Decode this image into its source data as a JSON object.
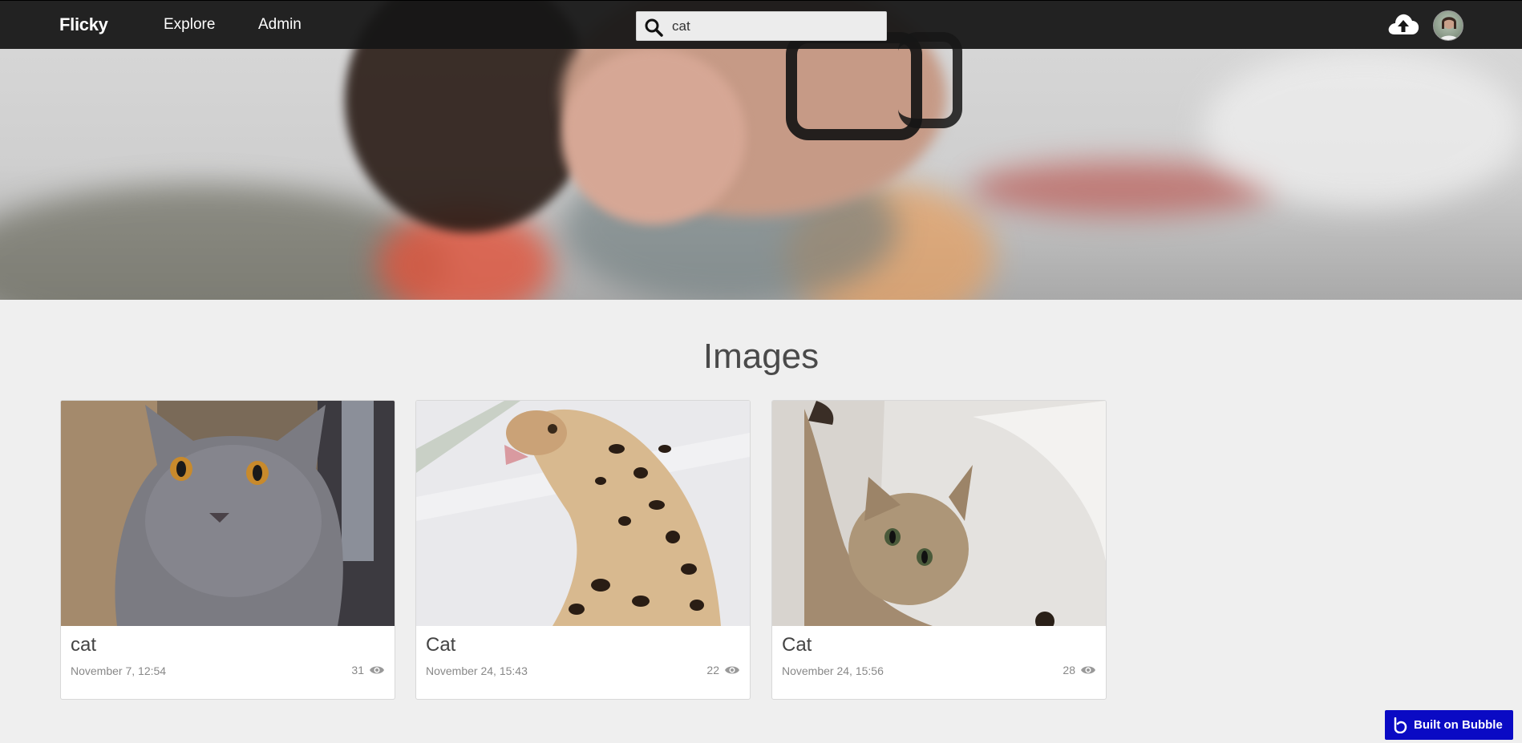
{
  "navbar": {
    "brand": "Flicky",
    "links": [
      "Explore",
      "Admin"
    ],
    "search_value": "cat",
    "upload_icon": "cloud-upload-icon",
    "avatar_icon": "user-avatar"
  },
  "hero": {
    "description_icon": "hero-banner-image"
  },
  "main": {
    "title": "Images",
    "cards": [
      {
        "title": "cat",
        "date": "November 7, 12:54",
        "views": "31",
        "icon": "eye-icon"
      },
      {
        "title": "Cat",
        "date": "November 24, 15:43",
        "views": "22",
        "icon": "eye-icon"
      },
      {
        "title": "Cat",
        "date": "November 24, 15:56",
        "views": "28",
        "icon": "eye-icon"
      }
    ]
  },
  "footer_badge": {
    "label": "Built on Bubble",
    "icon": "bubble-logo-icon"
  },
  "colors": {
    "navbar": "#161616",
    "badge": "#0a0ac4",
    "background": "#efefef"
  }
}
